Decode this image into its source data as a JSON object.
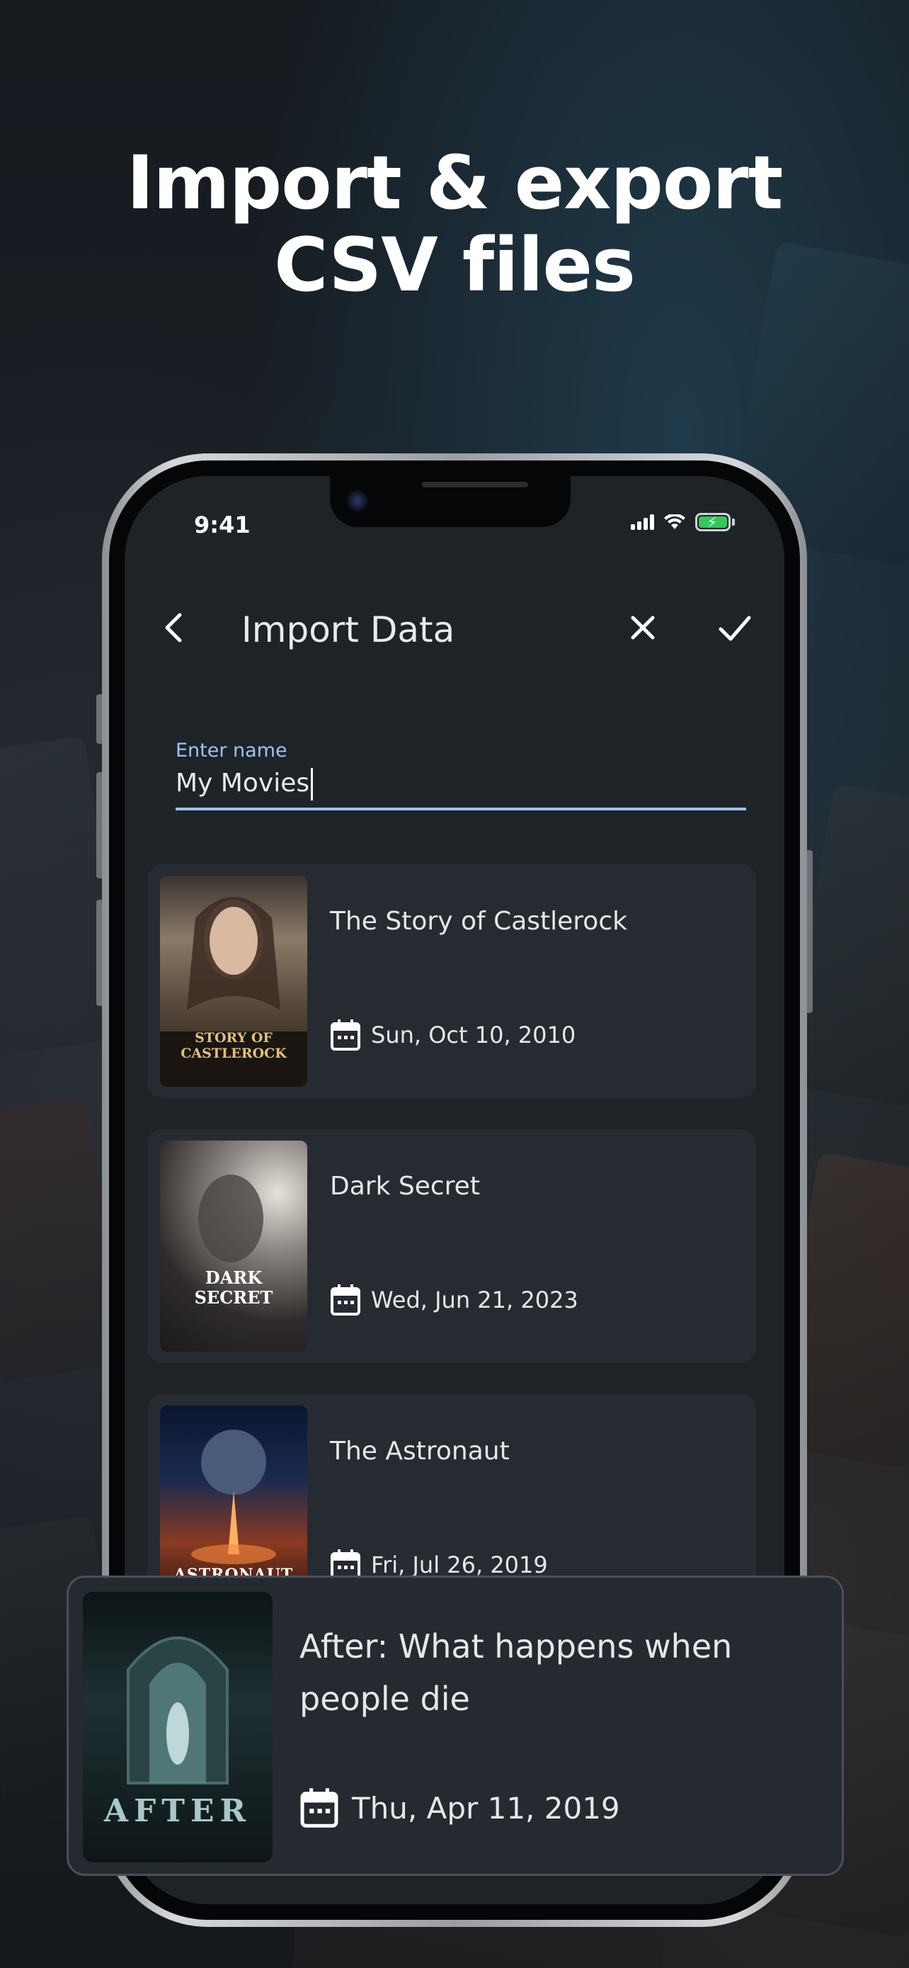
{
  "headline": {
    "line1": "Import & export",
    "line2": "CSV files"
  },
  "status_bar": {
    "time": "9:41"
  },
  "toolbar": {
    "title": "Import Data",
    "back_icon": "chevron-left-icon",
    "close_icon": "close-icon",
    "confirm_icon": "checkmark-icon"
  },
  "name_field": {
    "label": "Enter name",
    "value": "My Movies"
  },
  "movies": [
    {
      "title": "The Story of Castlerock",
      "date": "Sun, Oct 10, 2010",
      "poster_text": "STORY OF CASTLEROCK"
    },
    {
      "title": "Dark Secret",
      "date": "Wed, Jun 21, 2023",
      "poster_text": "DARK SECRET"
    },
    {
      "title": "The Astronaut",
      "date": "Fri, Jul 26, 2019",
      "poster_text": "ASTRONAUT"
    }
  ],
  "floating_movie": {
    "title": "After: What happens when people die",
    "date": "Thu, Apr 11, 2019",
    "poster_text": "AFTER"
  },
  "colors": {
    "accent": "#9cc4ee",
    "card_bg": "#262b31",
    "screen_bg": "#1e2328",
    "battery": "#34c759"
  }
}
